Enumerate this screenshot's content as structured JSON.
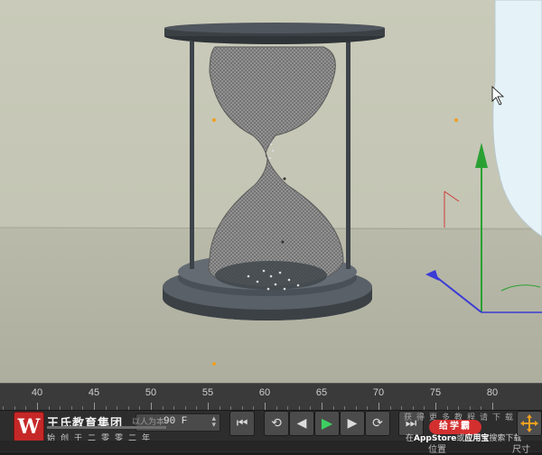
{
  "viewport": {
    "object": "hourglass",
    "background_color": "#c3c4b3",
    "floor_color": "#b5b6a6",
    "axis_colors": {
      "x": "#3b3bd6",
      "y": "#2aa033",
      "z": "#d03b3b"
    }
  },
  "timeline": {
    "ticks": [
      "40",
      "45",
      "50",
      "55",
      "60",
      "65",
      "70",
      "75",
      "80"
    ]
  },
  "toolbar": {
    "logo_glyph": "W",
    "brand_name": "王氏教育集团",
    "brand_slogan": "始创于二零零二年",
    "watermark_motto": "以人为本",
    "frame_value": "90 F",
    "buttons": {
      "go_start": "⏮",
      "prev_key": "⟲",
      "prev_frame": "◀",
      "play": "▶",
      "next_frame": "▶",
      "next_key": "⟳",
      "go_end": "⏭"
    },
    "watermark_line1": "获得更多教程请下载",
    "watermark_badge": "给学霸",
    "watermark_line2_prefix": "在",
    "watermark_line2_store": "AppStore",
    "watermark_line2_mid": "或",
    "watermark_line2_app": "应用宝",
    "watermark_line2_suffix": "搜索下载",
    "label_position": "位置",
    "label_size": "尺寸"
  }
}
